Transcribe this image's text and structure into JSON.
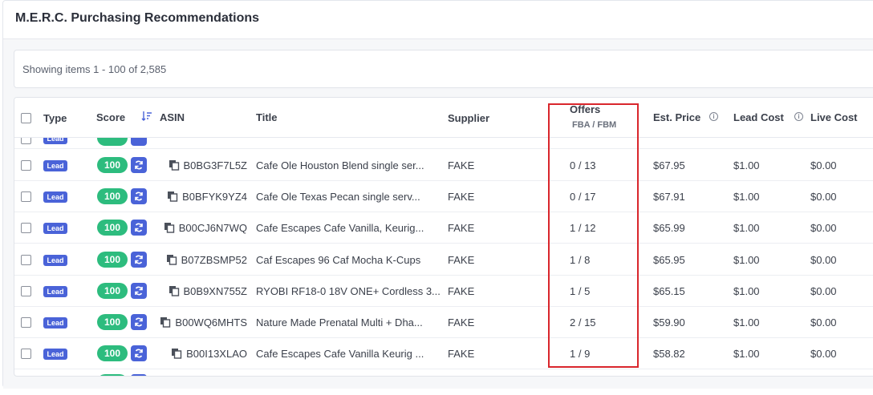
{
  "page": {
    "title": "M.E.R.C. Purchasing Recommendations"
  },
  "info": {
    "showing": "Showing items 1 - 100 of 2,585"
  },
  "columns": {
    "type": "Type",
    "score": "Score",
    "asin": "ASIN",
    "title": "Title",
    "supplier": "Supplier",
    "offers": "Offers",
    "offers_sub": "FBA / FBM",
    "est_price": "Est. Price",
    "lead_cost": "Lead Cost",
    "live_cost": "Live Cost"
  },
  "badge_label": "Lead",
  "rows": [
    {
      "type": "Lead",
      "score": "100",
      "asin": "B0BG3F7L5Z",
      "title": "Cafe Ole Houston Blend single ser...",
      "supplier": "FAKE",
      "offers": "0 / 13",
      "est_price": "$67.95",
      "lead_cost": "$1.00",
      "live_cost": "$0.00"
    },
    {
      "type": "Lead",
      "score": "100",
      "asin": "B0BFYK9YZ4",
      "title": "Cafe Ole Texas Pecan single serv...",
      "supplier": "FAKE",
      "offers": "0 / 17",
      "est_price": "$67.91",
      "lead_cost": "$1.00",
      "live_cost": "$0.00"
    },
    {
      "type": "Lead",
      "score": "100",
      "asin": "B00CJ6N7WQ",
      "title": "Cafe Escapes Cafe Vanilla, Keurig...",
      "supplier": "FAKE",
      "offers": "1 / 12",
      "est_price": "$65.99",
      "lead_cost": "$1.00",
      "live_cost": "$0.00"
    },
    {
      "type": "Lead",
      "score": "100",
      "asin": "B07ZBSMP52",
      "title": "Caf Escapes 96 Caf Mocha K-Cups",
      "supplier": "FAKE",
      "offers": "1 / 8",
      "est_price": "$65.95",
      "lead_cost": "$1.00",
      "live_cost": "$0.00"
    },
    {
      "type": "Lead",
      "score": "100",
      "asin": "B0B9XN755Z",
      "title": "RYOBI RF18-0 18V ONE+ Cordless 3...",
      "supplier": "FAKE",
      "offers": "1 / 5",
      "est_price": "$65.15",
      "lead_cost": "$1.00",
      "live_cost": "$0.00"
    },
    {
      "type": "Lead",
      "score": "100",
      "asin": "B00WQ6MHTS",
      "title": "Nature Made Prenatal Multi + Dha...",
      "supplier": "FAKE",
      "offers": "2 / 15",
      "est_price": "$59.90",
      "lead_cost": "$1.00",
      "live_cost": "$0.00"
    },
    {
      "type": "Lead",
      "score": "100",
      "asin": "B00I13XLAO",
      "title": "Cafe Escapes Cafe Vanilla Keurig ...",
      "supplier": "FAKE",
      "offers": "1 / 9",
      "est_price": "$58.82",
      "lead_cost": "$1.00",
      "live_cost": "$0.00"
    }
  ],
  "colors": {
    "accent": "#4a63d8",
    "score": "#2dbc7e",
    "highlight": "#d9262c"
  },
  "icons": {
    "sort": "sort-descending-icon",
    "copy": "copy-icon",
    "refresh": "refresh-icon",
    "info": "info-icon"
  }
}
